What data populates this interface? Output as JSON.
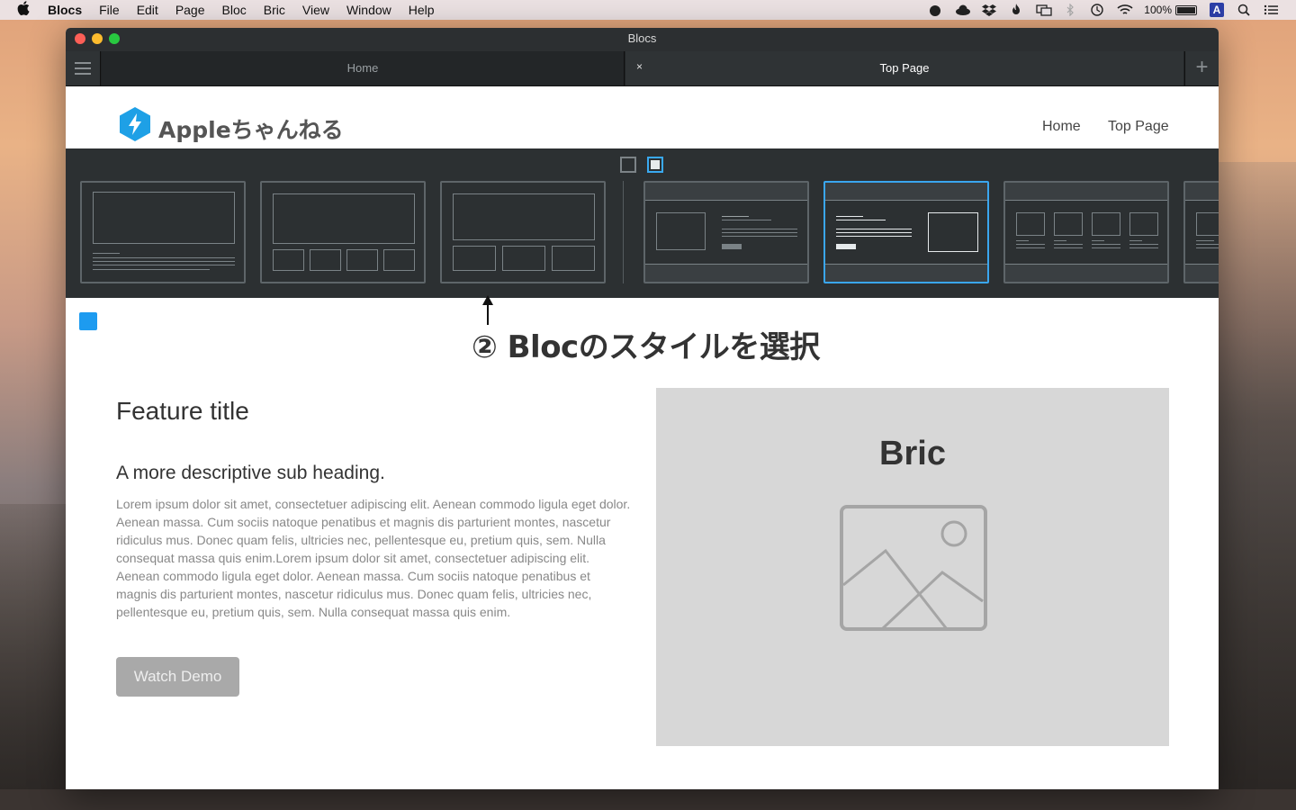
{
  "menubar": {
    "app_name": "Blocs",
    "items": [
      "File",
      "Edit",
      "Page",
      "Bloc",
      "Bric",
      "View",
      "Window",
      "Help"
    ],
    "battery": "100%",
    "ime": "A"
  },
  "window": {
    "title": "Blocs",
    "tabs": [
      {
        "label": "Home"
      },
      {
        "label": "Top Page",
        "close": "×"
      }
    ],
    "add_tab": "+"
  },
  "site": {
    "logo_text": "Appleちゃんねる",
    "nav": [
      "Home",
      "Top Page"
    ]
  },
  "annotation": "② Blocのスタイルを選択",
  "content": {
    "feature_title": "Feature title",
    "sub_heading": "A more descriptive sub heading.",
    "body": "Lorem ipsum dolor sit amet, consectetuer adipiscing elit. Aenean commodo ligula eget dolor. Aenean massa. Cum sociis natoque penatibus et magnis dis parturient montes, nascetur ridiculus mus. Donec quam felis, ultricies nec, pellentesque eu, pretium quis, sem. Nulla consequat massa quis enim.Lorem ipsum dolor sit amet, consectetuer adipiscing elit. Aenean commodo ligula eget dolor. Aenean massa. Cum sociis natoque penatibus et magnis dis parturient montes, nascetur ridiculus mus. Donec quam felis, ultricies nec, pellentesque eu, pretium quis, sem. Nulla consequat massa quis enim.",
    "button": "Watch Demo",
    "bric_title": "Bric"
  },
  "colors": {
    "accent": "#1d9bf0",
    "selected_thumb": "#3aa6ef",
    "logo": "#1ea0e6"
  }
}
